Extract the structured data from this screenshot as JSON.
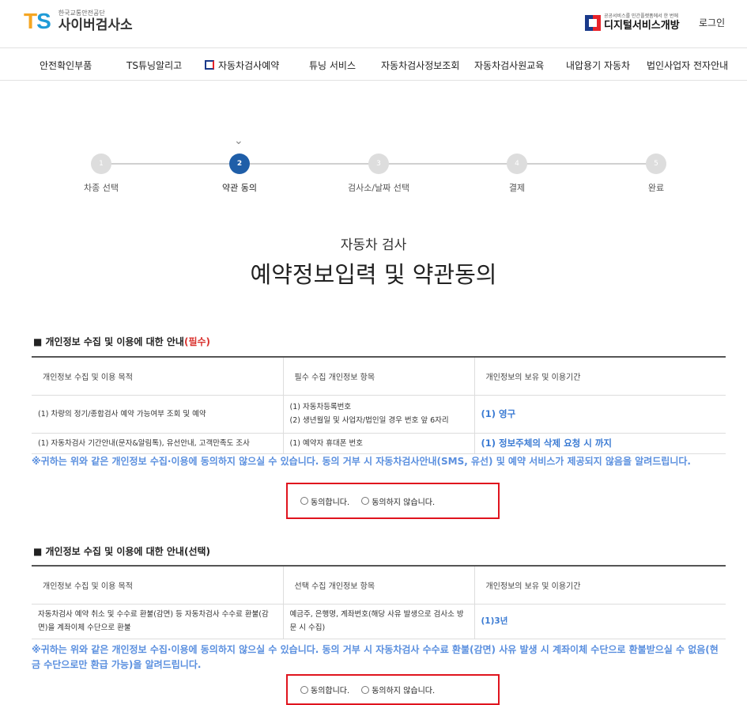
{
  "header": {
    "logo_mark_t": "T",
    "logo_mark_s": "S",
    "logo_small": "한국교통안전공단",
    "logo_big": "사이버검사소",
    "digital_small": "공공서비스를 민간플랫폼에서 한 번에",
    "digital_big": "디지털서비스개방",
    "login": "로그인"
  },
  "nav": {
    "items": [
      {
        "label": "안전확인부품"
      },
      {
        "label": "TS튜닝알리고"
      },
      {
        "label": "자동차검사예약"
      },
      {
        "label": "튜닝 서비스"
      },
      {
        "label": "자동차검사정보조회"
      },
      {
        "label": "자동차검사원교육"
      },
      {
        "label": "내압용기 자동차"
      },
      {
        "label": "법인사업자 전자안내"
      }
    ]
  },
  "steps": [
    {
      "number": "1",
      "label": "차종 선택"
    },
    {
      "number": "2",
      "label": "약관 동의"
    },
    {
      "number": "3",
      "label": "검사소/날짜 선택"
    },
    {
      "number": "4",
      "label": "결제"
    },
    {
      "number": "5",
      "label": "완료"
    }
  ],
  "active_step": 2,
  "page": {
    "subtitle": "자동차 검사",
    "title": "예약정보입력 및 약관동의"
  },
  "section1": {
    "title": "개인정보 수집 및 이용에 대한 안내",
    "required_tag": "(필수)",
    "headers": [
      "개인정보 수집 및 이용 목적",
      "필수 수집 개인정보 항목",
      "개인정보의 보유 및 이용기간"
    ],
    "rows": [
      {
        "purpose": "(1) 차량의 정기/종합검사 예약 가능여부 조회 및 예약",
        "item1": "(1) 자동차등록번호",
        "item2": "(2) 생년월일 및 사업자/법인일 경우 번호 앞 6자리",
        "period": "(1) 영구"
      },
      {
        "purpose": "(1) 자동차검사 기간안내(문자&알림톡), 유선안내, 고객만족도 조사",
        "item1": "(1) 예약자 휴대폰 번호",
        "period": "(1) 정보주체의 삭제 요청 시 까지"
      }
    ],
    "notice": "※귀하는 위와 같은 개인정보 수집·이용에 동의하지 않으실 수 있습니다. 동의 거부 시 자동차검사안내(SMS, 유선) 및 예약 서비스가 제공되지 않음을 알려드립니다.",
    "agree": "동의합니다.",
    "disagree": "동의하지 않습니다."
  },
  "section2": {
    "title": "개인정보 수집 및 이용에 대한 안내(선택)",
    "headers": [
      "개인정보 수집 및 이용 목적",
      "선택 수집 개인정보 항목",
      "개인정보의 보유 및 이용기간"
    ],
    "rows": [
      {
        "purpose": "자동차검사 예약 취소 및 수수료 환불(감면) 등 자동차검사 수수료 환불(감면)을 계좌이체 수단으로 환불",
        "item1": "예금주, 은행명, 계좌번호(해당 사유 발생으로 검사소 방문 시 수집)",
        "period": "(1)3년"
      }
    ],
    "notice": "※귀하는 위와 같은 개인정보 수집·이용에 동의하지 않으실 수 있습니다. 동의 거부 시 자동차검사 수수료 환불(감면) 사유 발생 시 계좌이체 수단으로 환불받으실 수 없음(현금 수단으로만 환급 가능)을 알려드립니다.",
    "agree": "동의합니다.",
    "disagree": "동의하지 않습니다."
  }
}
